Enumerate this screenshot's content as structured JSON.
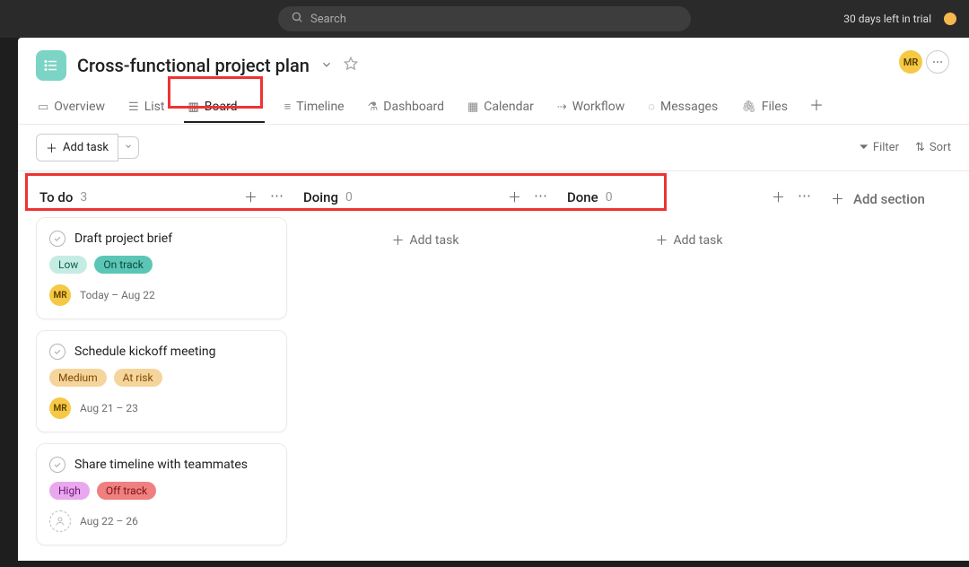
{
  "topbar": {
    "search_placeholder": "Search",
    "trial": "30 days left in trial"
  },
  "header": {
    "project_title": "Cross-functional project plan",
    "avatar_initials": "MR"
  },
  "tabs": {
    "overview": "Overview",
    "list": "List",
    "board": "Board",
    "timeline": "Timeline",
    "dashboard": "Dashboard",
    "calendar": "Calendar",
    "workflow": "Workflow",
    "messages": "Messages",
    "files": "Files"
  },
  "toolbar": {
    "add_task": "Add task",
    "filter": "Filter",
    "sort": "Sort"
  },
  "columns": {
    "todo": {
      "name": "To do",
      "count": "3"
    },
    "doing": {
      "name": "Doing",
      "count": "0",
      "add_task": "Add task"
    },
    "done": {
      "name": "Done",
      "count": "0",
      "add_task": "Add task"
    },
    "add_section": "Add section"
  },
  "cards": {
    "c1": {
      "title": "Draft project brief",
      "tag1": "Low",
      "tag2": "On track",
      "assignee": "MR",
      "date": "Today – Aug 22"
    },
    "c2": {
      "title": "Schedule kickoff meeting",
      "tag1": "Medium",
      "tag2": "At risk",
      "assignee": "MR",
      "date": "Aug 21 – 23"
    },
    "c3": {
      "title": "Share timeline with teammates",
      "tag1": "High",
      "tag2": "Off track",
      "date": "Aug 22 – 26"
    }
  }
}
